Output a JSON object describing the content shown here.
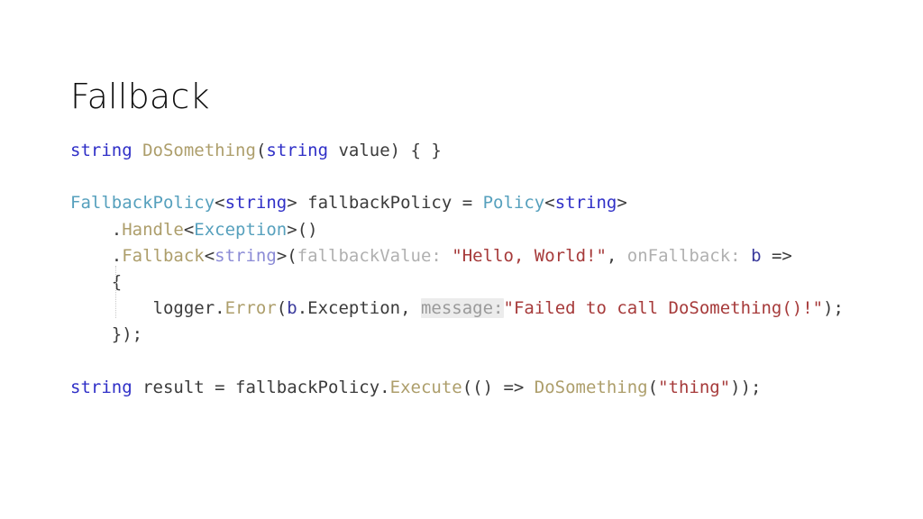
{
  "slide": {
    "title": "Fallback",
    "background_color": "#ffffff",
    "title_color": "#0d0d0d"
  },
  "palette": {
    "keyword": "#2f2fc7",
    "keyword_soft": "#8b8bd6",
    "type": "#56a0bd",
    "method": "#ad9e6b",
    "string_literal": "#a63a3a",
    "param_hint": "#b0b0b0",
    "param_hint_background": "#ececec",
    "variable": "#3a3a9c",
    "plain": "#3b3b3b"
  },
  "code": {
    "language": "csharp",
    "lines": [
      {
        "id": "line-1",
        "text": "string DoSomething(string value) { }",
        "tokens": [
          {
            "text": "string",
            "kind": "keyword"
          },
          {
            "text": " ",
            "kind": "plain"
          },
          {
            "text": "DoSomething",
            "kind": "method"
          },
          {
            "text": "(",
            "kind": "plain"
          },
          {
            "text": "string",
            "kind": "keyword"
          },
          {
            "text": " value) { }",
            "kind": "plain"
          }
        ]
      },
      {
        "id": "line-2",
        "text": "",
        "tokens": []
      },
      {
        "id": "line-3",
        "text": "FallbackPolicy<string> fallbackPolicy = Policy<string>",
        "tokens": [
          {
            "text": "FallbackPolicy",
            "kind": "type"
          },
          {
            "text": "<",
            "kind": "plain"
          },
          {
            "text": "string",
            "kind": "keyword"
          },
          {
            "text": "> fallbackPolicy = ",
            "kind": "plain"
          },
          {
            "text": "Policy",
            "kind": "type"
          },
          {
            "text": "<",
            "kind": "plain"
          },
          {
            "text": "string",
            "kind": "keyword"
          },
          {
            "text": ">",
            "kind": "plain"
          }
        ]
      },
      {
        "id": "line-4",
        "text": "    .Handle<Exception>()",
        "tokens": [
          {
            "text": "    .",
            "kind": "plain"
          },
          {
            "text": "Handle",
            "kind": "method"
          },
          {
            "text": "<",
            "kind": "plain"
          },
          {
            "text": "Exception",
            "kind": "type"
          },
          {
            "text": ">()",
            "kind": "plain"
          }
        ]
      },
      {
        "id": "line-5",
        "text": "    .Fallback<string>(fallbackValue: \"Hello, World!\", onFallback: b =>",
        "tokens": [
          {
            "text": "    .",
            "kind": "plain"
          },
          {
            "text": "Fallback",
            "kind": "method"
          },
          {
            "text": "<",
            "kind": "plain"
          },
          {
            "text": "string",
            "kind": "keyword_soft"
          },
          {
            "text": ">(",
            "kind": "plain"
          },
          {
            "text": "fallbackValue: ",
            "kind": "param_hint"
          },
          {
            "text": "\"Hello, World!\"",
            "kind": "string_literal"
          },
          {
            "text": ", ",
            "kind": "plain"
          },
          {
            "text": "onFallback: ",
            "kind": "param_hint"
          },
          {
            "text": "b",
            "kind": "variable"
          },
          {
            "text": " =>",
            "kind": "plain"
          }
        ]
      },
      {
        "id": "line-6",
        "text": "    {",
        "tokens": [
          {
            "text": "    {",
            "kind": "plain"
          }
        ]
      },
      {
        "id": "line-7",
        "text": "        logger.Error(b.Exception, message:\"Failed to call DoSomething()!\");",
        "tokens": [
          {
            "text": "        logger.",
            "kind": "plain"
          },
          {
            "text": "Error",
            "kind": "method"
          },
          {
            "text": "(",
            "kind": "plain"
          },
          {
            "text": "b",
            "kind": "variable"
          },
          {
            "text": ".Exception, ",
            "kind": "plain"
          },
          {
            "text": "message:",
            "kind": "param_hint_boxed"
          },
          {
            "text": "\"Failed to call DoSomething()!\"",
            "kind": "string_literal"
          },
          {
            "text": ");",
            "kind": "plain"
          }
        ]
      },
      {
        "id": "line-8",
        "text": "    });",
        "tokens": [
          {
            "text": "    });",
            "kind": "plain"
          }
        ]
      },
      {
        "id": "line-9",
        "text": "",
        "tokens": []
      },
      {
        "id": "line-10",
        "text": "string result = fallbackPolicy.Execute(() => DoSomething(\"thing\"));",
        "tokens": [
          {
            "text": "string",
            "kind": "keyword"
          },
          {
            "text": " result = fallbackPolicy.",
            "kind": "plain"
          },
          {
            "text": "Execute",
            "kind": "method"
          },
          {
            "text": "(() => ",
            "kind": "plain"
          },
          {
            "text": "DoSomething",
            "kind": "method"
          },
          {
            "text": "(",
            "kind": "plain"
          },
          {
            "text": "\"thing\"",
            "kind": "string_literal"
          },
          {
            "text": "));",
            "kind": "plain"
          }
        ]
      }
    ]
  }
}
